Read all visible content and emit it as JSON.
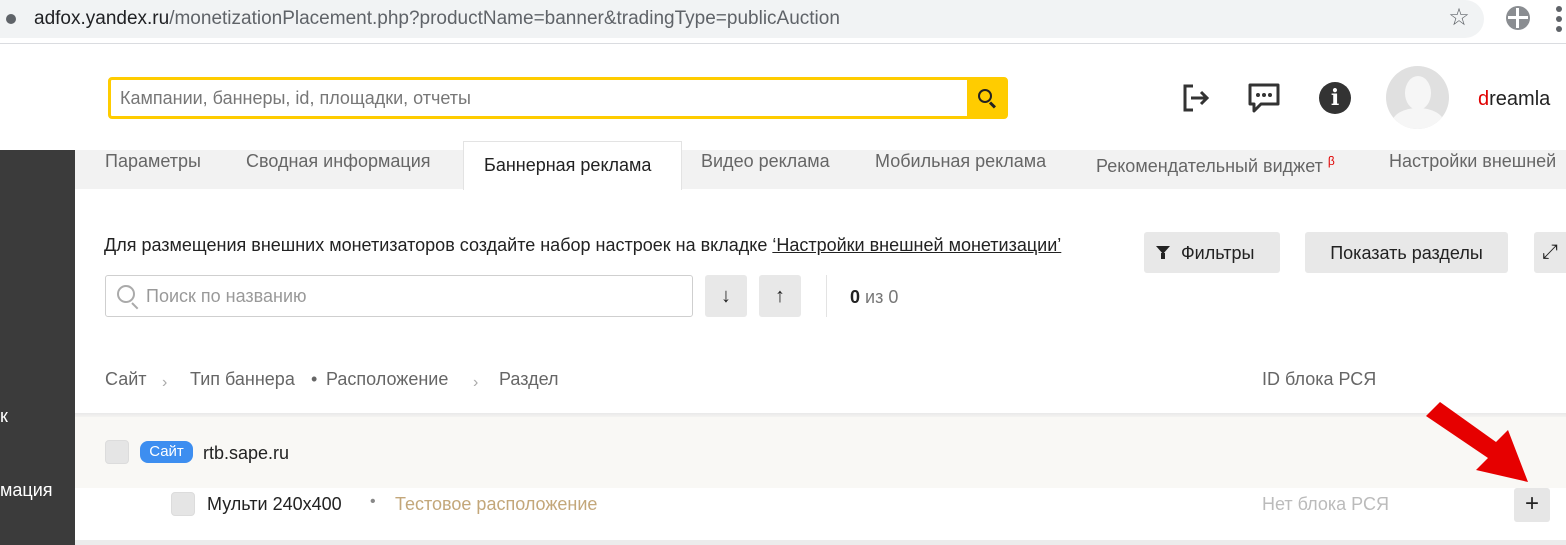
{
  "browser": {
    "url_host": "adfox.yandex.ru",
    "url_path": "/monetizationPlacement.php?productName=banner&tradingType=publicAuction"
  },
  "header": {
    "search_placeholder": "Кампании, баннеры, id, площадки, отчеты",
    "username_first": "d",
    "username_rest": "reamla"
  },
  "sidebar": {
    "labels": [
      "к",
      "мация"
    ]
  },
  "tabs": [
    {
      "label": "Параметры"
    },
    {
      "label": "Сводная информация"
    },
    {
      "label": "Баннерная реклама",
      "active": true
    },
    {
      "label": "Видео реклама"
    },
    {
      "label": "Мобильная реклама"
    },
    {
      "label": "Рекомендательный виджет",
      "sup": "β"
    },
    {
      "label": "Настройки внешней"
    }
  ],
  "info": {
    "text": "Для размещения внешних монетизаторов создайте набор настроек на вкладке ",
    "link": "‘Настройки внешней монетизации’"
  },
  "toolbar": {
    "filters_label": "Фильтры",
    "sections_label": "Показать разделы",
    "name_search_placeholder": "Поиск по названию",
    "counter_current": "0",
    "counter_total": "из 0"
  },
  "columns": {
    "site": "Сайт",
    "banner_type": "Тип баннера",
    "bullet": "•",
    "placement": "Расположение",
    "section": "Раздел",
    "rsya_id": "ID блока РСЯ"
  },
  "rows": {
    "site_badge": "Сайт",
    "site_name": "rtb.sape.ru",
    "banner_type": "Мульти 240x400",
    "placement": "Тестовое расположение",
    "rsya": "Нет блока РСЯ",
    "add_label": "+"
  },
  "colors": {
    "accent_yellow": "#ffcc00",
    "badge_blue": "#3d8ef0",
    "arrow_red": "#e60000",
    "placement_gold": "#c3a77a"
  }
}
